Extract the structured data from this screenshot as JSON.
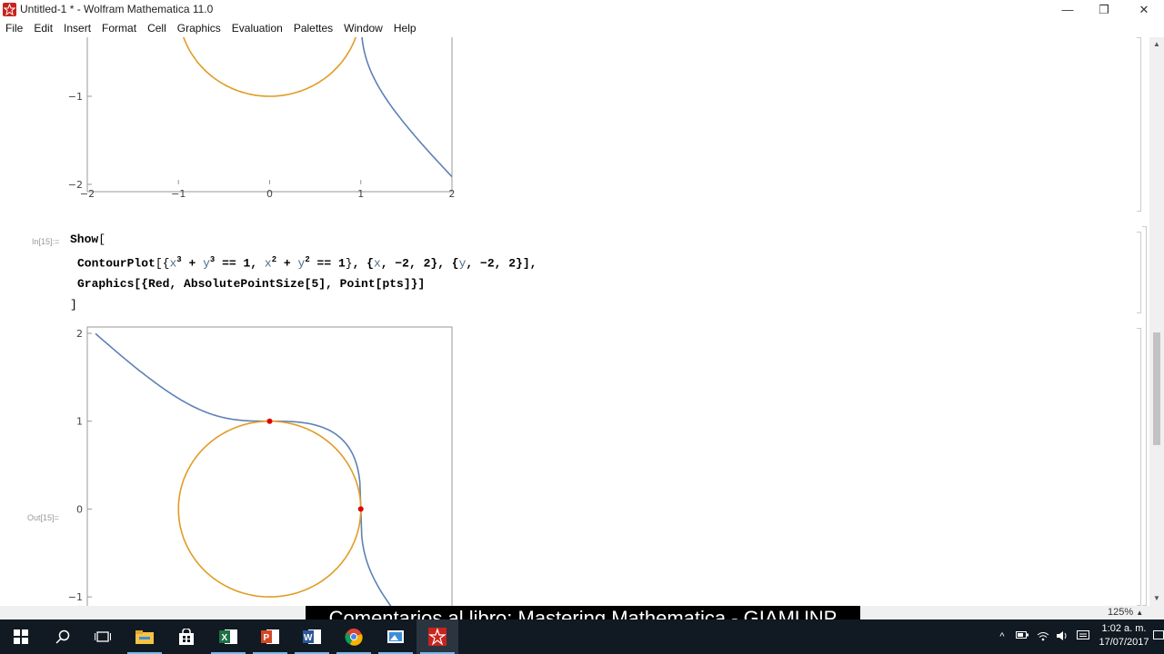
{
  "window": {
    "title": "Untitled-1 * - Wolfram Mathematica 11.0",
    "controls": {
      "minimize": "—",
      "restore": "❐",
      "close": "✕"
    }
  },
  "menu": [
    "File",
    "Edit",
    "Insert",
    "Format",
    "Cell",
    "Graphics",
    "Evaluation",
    "Palettes",
    "Window",
    "Help"
  ],
  "cell_in": {
    "label": "In[15]:="
  },
  "cell_out": {
    "label": "Out[15]="
  },
  "code": {
    "show": "Show",
    "open_bracket": "[",
    "close_bracket": "]",
    "contour_head": "ContourPlot",
    "line2_tail": "},",
    "graphics_line": "Graphics[{Red, AbsolutePointSize[5], Point[pts]}]"
  },
  "plot_top": {
    "y_ticks": [
      "−1",
      "−2"
    ],
    "x_ticks": [
      "−2",
      "−1",
      "0",
      "1",
      "2"
    ]
  },
  "plot_bottom": {
    "y_ticks": [
      "2",
      "1",
      "0",
      "−1"
    ]
  },
  "chart_data": {
    "type": "line",
    "series": [
      {
        "name": "",
        "equation": "x^3 + y^3 == 1",
        "color": "#5e81b5"
      },
      {
        "name": "",
        "equation": "x^2 + y^2 == 1",
        "color": "#e19c24"
      }
    ],
    "points": [
      {
        "x": 0,
        "y": 1
      },
      {
        "x": 1,
        "y": 0
      }
    ],
    "point_color": "#e00000",
    "xlim": [
      -2,
      2
    ],
    "ylim": [
      -2,
      2
    ]
  },
  "status": {
    "zoom": "125%"
  },
  "caption": "Comentarios al libro: Mastering Mathematica - GIAMUNP",
  "taskbar": {
    "clock_time": "1:02 a. m.",
    "clock_date": "17/07/2017",
    "apps": [
      "start",
      "search",
      "task-view",
      "file-explorer",
      "store",
      "excel",
      "powerpoint",
      "word",
      "chrome",
      "photos",
      "mathematica"
    ]
  }
}
